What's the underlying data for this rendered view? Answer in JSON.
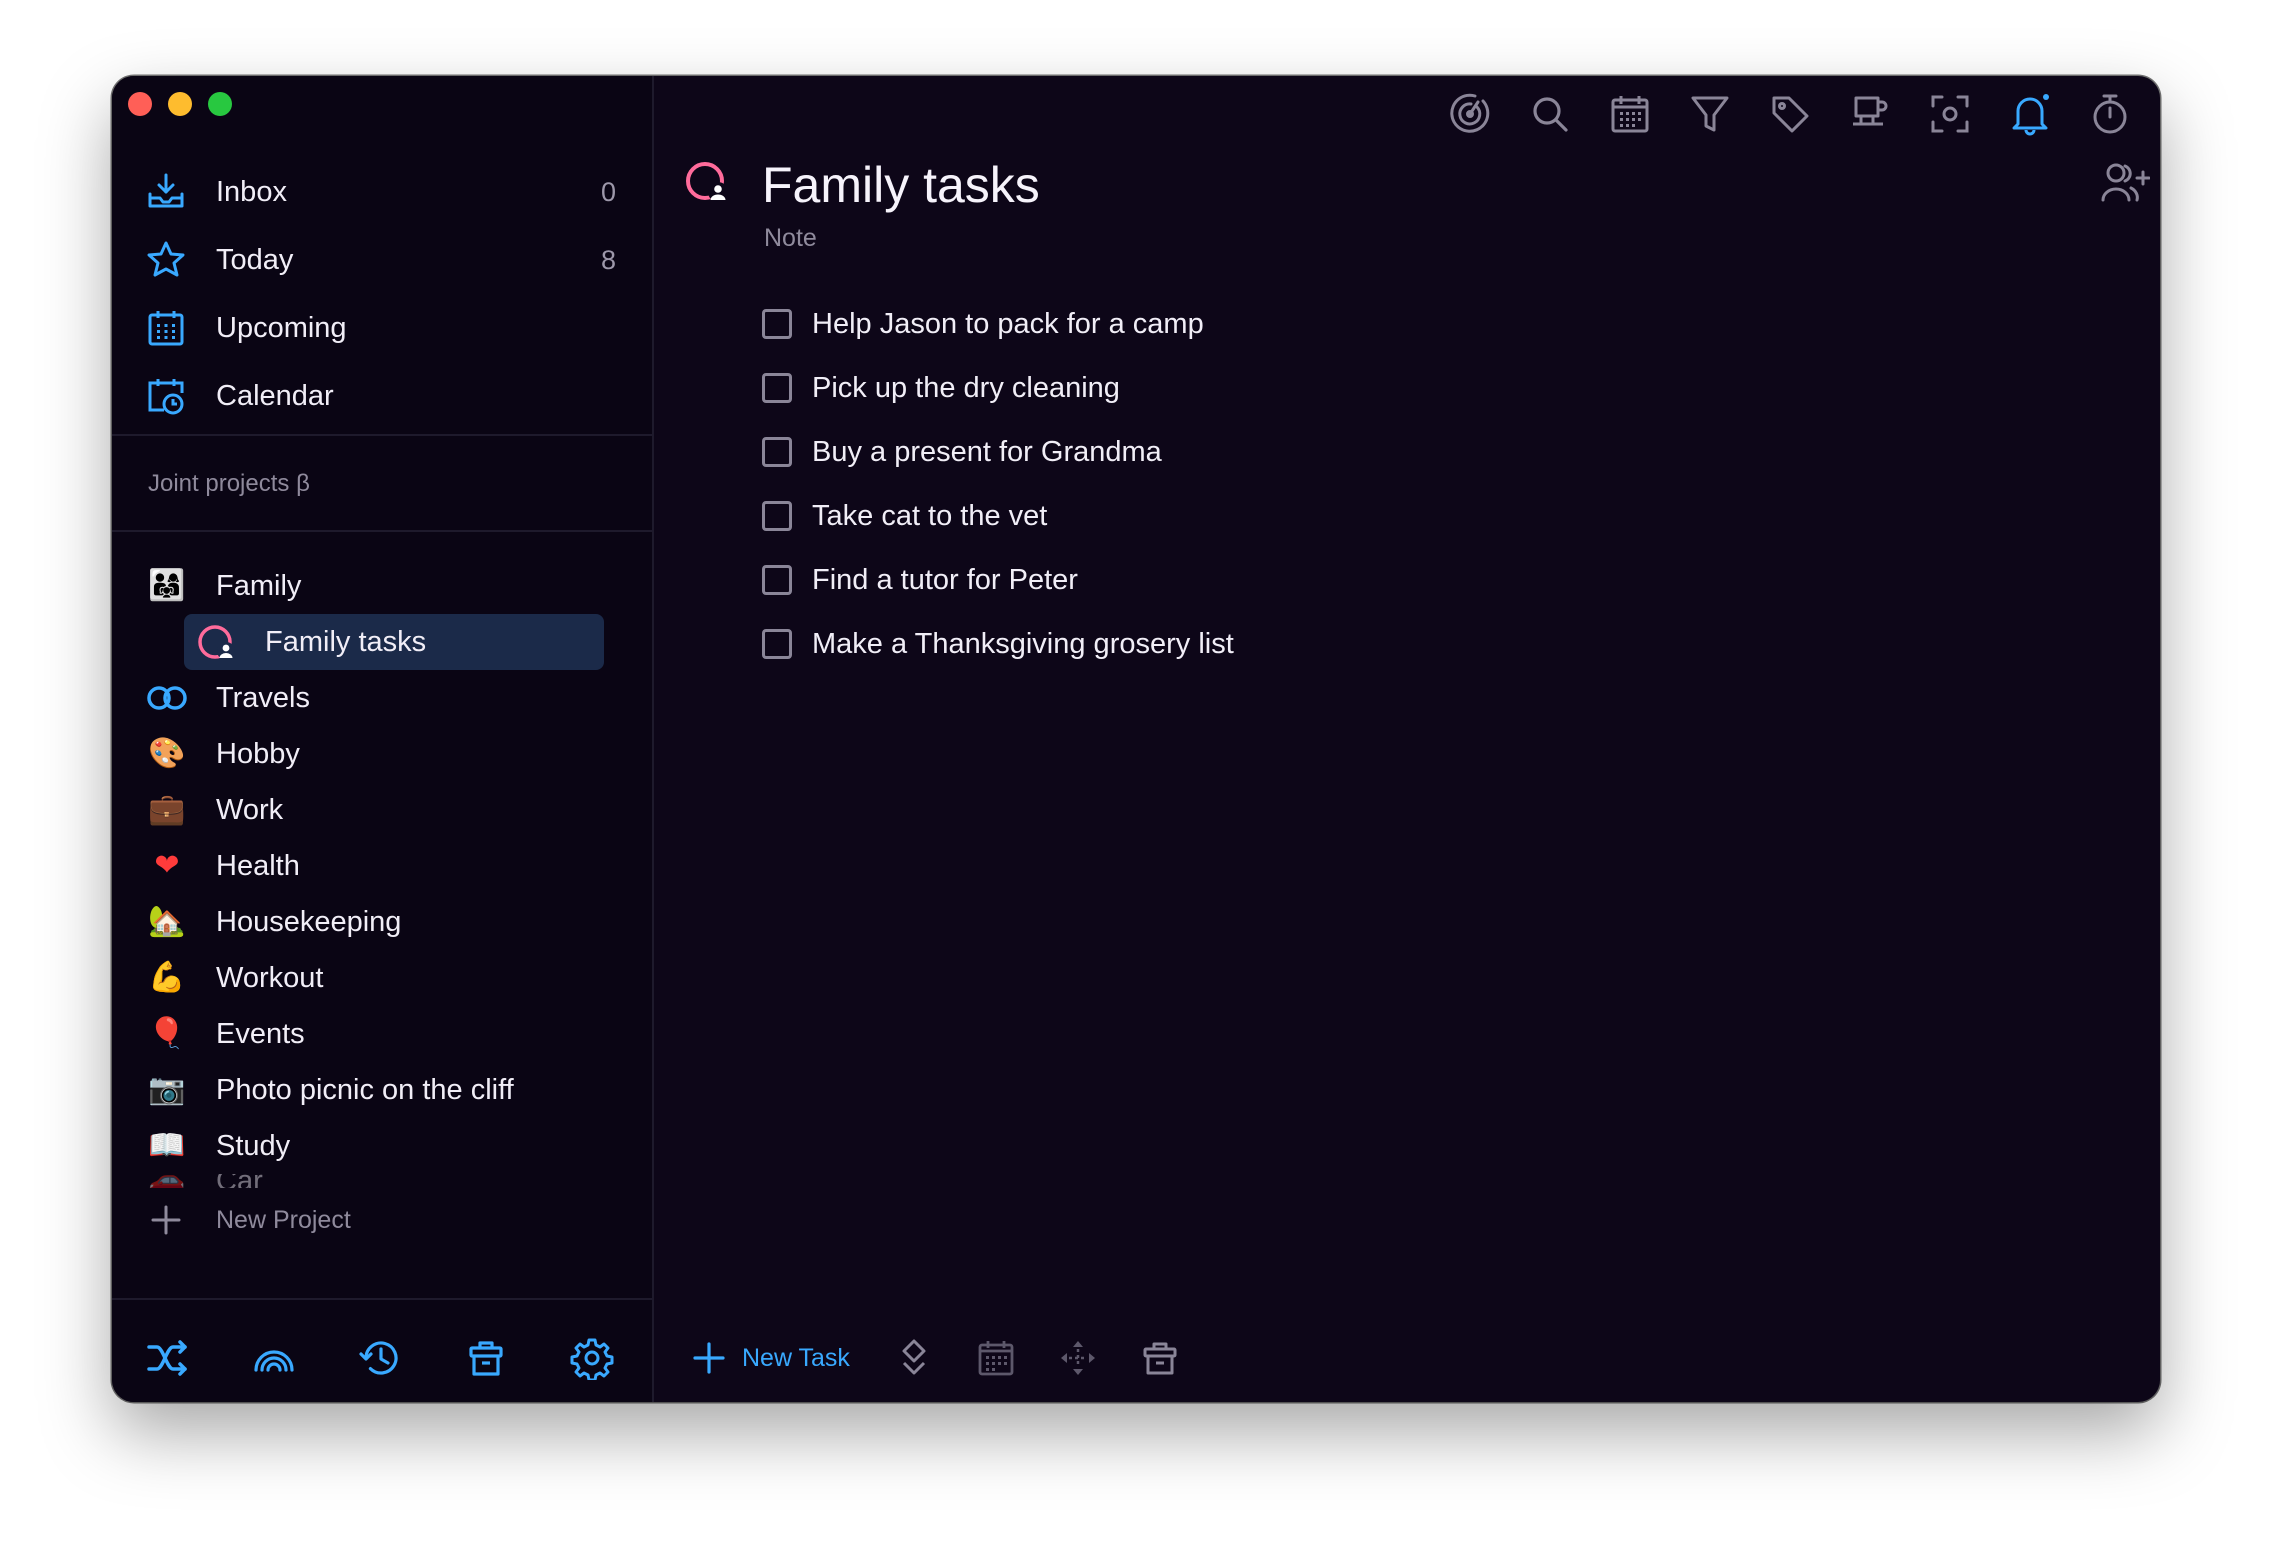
{
  "colors": {
    "accent": "#39a9ff",
    "window_bg": "#0d0618",
    "selected_row": "#1b2a49",
    "project_icon": "#ff6b9b"
  },
  "sidebar": {
    "nav": [
      {
        "label": "Inbox",
        "count": "0",
        "icon": "inbox-icon"
      },
      {
        "label": "Today",
        "count": "8",
        "icon": "star-icon"
      },
      {
        "label": "Upcoming",
        "count": "",
        "icon": "calendar-grid-icon"
      },
      {
        "label": "Calendar",
        "count": "",
        "icon": "calendar-clock-icon"
      }
    ],
    "joint_projects_label": "Joint projects β",
    "projects": [
      {
        "label": "Family",
        "emoji": "👨‍👩‍👧"
      },
      {
        "label": "Family tasks",
        "icon": "shared-list-icon",
        "selected": true
      },
      {
        "label": "Travels",
        "icon": "infinity-icon"
      },
      {
        "label": "Hobby",
        "emoji": "🎨"
      },
      {
        "label": "Work",
        "emoji": "💼"
      },
      {
        "label": "Health",
        "emoji": "❤️"
      },
      {
        "label": "Housekeeping",
        "emoji": "🏡"
      },
      {
        "label": "Workout",
        "emoji": "💪"
      },
      {
        "label": "Events",
        "emoji": "🎈"
      },
      {
        "label": "Photo picnic on the cliff",
        "emoji": "📷"
      },
      {
        "label": "Study",
        "emoji": "📖"
      },
      {
        "label": "Car",
        "emoji": "🚗"
      }
    ],
    "new_project_label": "New Project",
    "bottom_icons": [
      "shuffle-icon",
      "airdrop-icon",
      "history-icon",
      "trash-icon",
      "settings-icon"
    ]
  },
  "toolbar": {
    "icons": [
      "focus-icon",
      "search-icon",
      "calendar-icon",
      "filter-icon",
      "tag-icon",
      "coffee-icon",
      "capture-icon",
      "bell-icon",
      "timer-icon",
      "duplicate-icon"
    ]
  },
  "list": {
    "title": "Family tasks",
    "note": "Note",
    "tasks": [
      "Help Jason to pack for a camp",
      "Pick up the dry cleaning",
      "Buy a present for Grandma",
      "Take cat to the vet",
      "Find a tutor for Peter",
      "Make a Thanksgiving grosery list"
    ]
  },
  "bottom_bar": {
    "new_task_label": "New Task",
    "icons": [
      "priority-icon",
      "date-icon",
      "move-icon",
      "delete-icon",
      "sync-icon"
    ]
  }
}
